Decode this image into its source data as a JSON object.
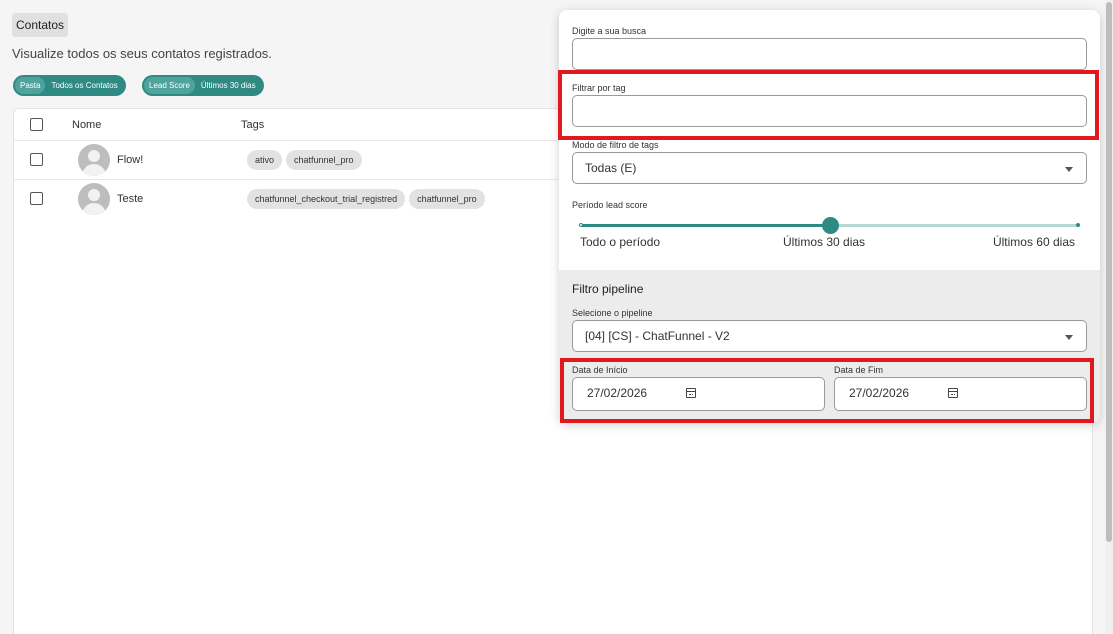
{
  "header": {
    "title": "Contatos",
    "subtitle": "Visualize todos os seus contatos registrados."
  },
  "filter_chips": [
    {
      "key": "Pasta",
      "value": "Todos os Contatos"
    },
    {
      "key": "Lead Score",
      "value": "Últimos 30 dias"
    }
  ],
  "table": {
    "columns": [
      "Nome",
      "Tags"
    ],
    "rows": [
      {
        "name": "Flow!",
        "tags": [
          "ativo",
          "chatfunnel_pro"
        ]
      },
      {
        "name": "Teste",
        "tags": [
          "chatfunnel_checkout_trial_registred",
          "chatfunnel_pro"
        ]
      }
    ]
  },
  "panel": {
    "search": {
      "label": "Digite a sua busca",
      "value": ""
    },
    "tag_filter": {
      "label": "Filtrar por tag",
      "value": ""
    },
    "tag_mode": {
      "label": "Modo de filtro de tags",
      "value": "Todas (E)"
    },
    "lead_score": {
      "label": "Período lead score",
      "marks": [
        "Todo o período",
        "Últimos 30 dias",
        "Últimos 60 dias"
      ],
      "selected_index": 1,
      "fraction": 0.5
    },
    "pipeline": {
      "section_title": "Filtro pipeline",
      "select_label": "Selecione o pipeline",
      "value": "[04] [CS] - ChatFunnel - V2"
    },
    "dates": {
      "start_label": "Data de Início",
      "start_value": "27/02/2026",
      "end_label": "Data de Fim",
      "end_value": "27/02/2026"
    }
  },
  "colors": {
    "accent": "#2f8a84",
    "highlight": "#e0191f"
  }
}
